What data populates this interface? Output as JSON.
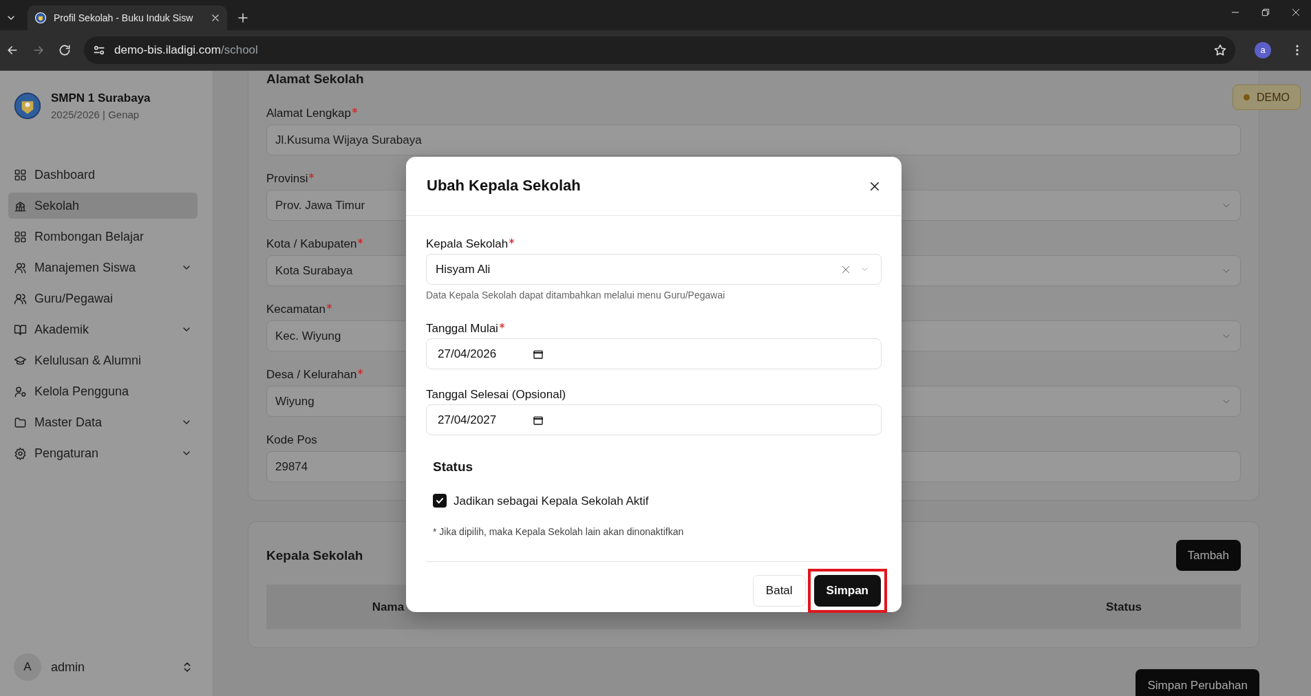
{
  "browser": {
    "tab_title": "Profil Sekolah - Buku Induk Sisw",
    "url_host": "demo-bis.iladigi.com",
    "url_path": "/school",
    "profile_initial": "a"
  },
  "sidebar": {
    "school_name": "SMPN 1 Surabaya",
    "period": "2025/2026 | Genap",
    "items": [
      {
        "label": "Dashboard",
        "selected": false,
        "expandable": false
      },
      {
        "label": "Sekolah",
        "selected": true,
        "expandable": false
      },
      {
        "label": "Rombongan Belajar",
        "selected": false,
        "expandable": false
      },
      {
        "label": "Manajemen Siswa",
        "selected": false,
        "expandable": true
      },
      {
        "label": "Guru/Pegawai",
        "selected": false,
        "expandable": false
      },
      {
        "label": "Akademik",
        "selected": false,
        "expandable": true
      },
      {
        "label": "Kelulusan & Alumni",
        "selected": false,
        "expandable": false
      },
      {
        "label": "Kelola Pengguna",
        "selected": false,
        "expandable": false
      },
      {
        "label": "Master Data",
        "selected": false,
        "expandable": true
      },
      {
        "label": "Pengaturan",
        "selected": false,
        "expandable": true
      }
    ],
    "user": {
      "initial": "A",
      "name": "admin"
    }
  },
  "badge": "DEMO",
  "address_section": {
    "title": "Alamat Sekolah",
    "fields": [
      {
        "label": "Alamat Lengkap",
        "required": true,
        "kind": "text",
        "value": "Jl.Kusuma Wijaya Surabaya"
      },
      {
        "label": "Provinsi",
        "required": true,
        "kind": "select",
        "value": "Prov. Jawa Timur"
      },
      {
        "label": "Kota / Kabupaten",
        "required": true,
        "kind": "select",
        "value": "Kota Surabaya"
      },
      {
        "label": "Kecamatan",
        "required": true,
        "kind": "select",
        "value": "Kec. Wiyung"
      },
      {
        "label": "Desa / Kelurahan",
        "required": true,
        "kind": "select",
        "value": "Wiyung"
      },
      {
        "label": "Kode Pos",
        "required": false,
        "kind": "text",
        "value": "29874"
      }
    ]
  },
  "principal_section": {
    "title": "Kepala Sekolah",
    "add_button": "Tambah",
    "columns": [
      "Nama",
      "Status"
    ]
  },
  "save_button": "Simpan Perubahan",
  "modal": {
    "title": "Ubah Kepala Sekolah",
    "fields": [
      {
        "label": "Kepala Sekolah",
        "required": true,
        "kind": "select",
        "value": "Hisyam Ali",
        "help": "Data Kepala Sekolah dapat ditambahkan melalui menu Guru/Pegawai"
      },
      {
        "label": "Tanggal Mulai",
        "required": true,
        "kind": "date",
        "value": "27/04/2026"
      },
      {
        "label": "Tanggal Selesai (Opsional)",
        "required": false,
        "kind": "date",
        "value": "27/04/2027"
      }
    ],
    "status_title": "Status",
    "checkbox": {
      "label": "Jadikan sebagai Kepala Sekolah Aktif",
      "checked": true
    },
    "note": "* Jika dipilih, maka Kepala Sekolah lain akan dinonaktifkan",
    "cancel_button": "Batal",
    "submit_button": {
      "label": "Simpan",
      "highlighted": true
    }
  }
}
